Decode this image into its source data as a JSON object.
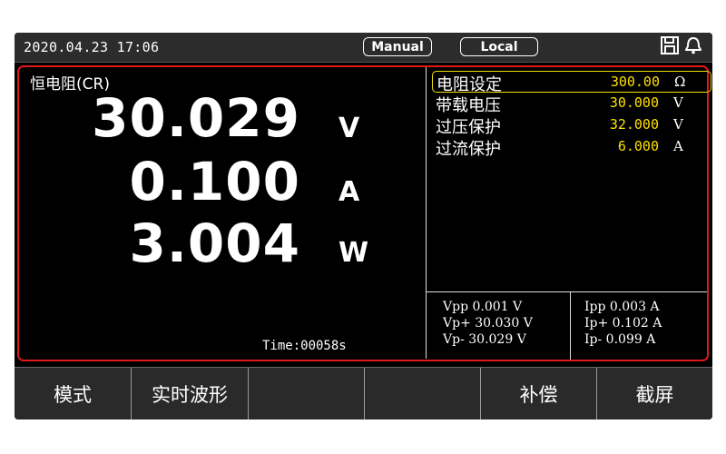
{
  "status": {
    "datetime": "2020.04.23 17:06",
    "mode_badge": "Manual",
    "remote_badge": "Local"
  },
  "readings": {
    "mode_label": "恒电阻(CR)",
    "voltage": "30.029",
    "voltage_unit": "V",
    "current": "0.100",
    "current_unit": "A",
    "power": "3.004",
    "power_unit": "W",
    "time": "Time:00058s"
  },
  "params": [
    {
      "label": "电阻设定",
      "value": "300.00",
      "unit": "Ω"
    },
    {
      "label": "带载电压",
      "value": "30.000",
      "unit": "V"
    },
    {
      "label": "过压保护",
      "value": "32.000",
      "unit": "V"
    },
    {
      "label": "过流保护",
      "value": "6.000",
      "unit": "A"
    }
  ],
  "stats": {
    "vpp": "Vpp 0.001 V",
    "vp_plus": "Vp+ 30.030 V",
    "vp_minus": "Vp- 30.029 V",
    "ipp": "Ipp 0.003 A",
    "ip_plus": "Ip+ 0.102 A",
    "ip_minus": "Ip- 0.099 A"
  },
  "softkeys": [
    "模式",
    "实时波形",
    "",
    "",
    "补偿",
    "截屏"
  ],
  "icons": [
    "save-icon",
    "bell-icon"
  ],
  "colors": {
    "accent_red": "#e01818",
    "value_yellow": "#ffe000",
    "select_border": "#f0e000"
  }
}
